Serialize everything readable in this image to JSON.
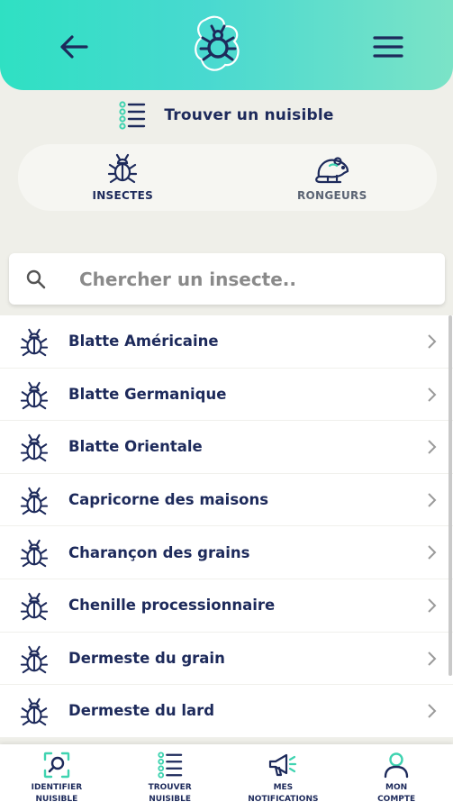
{
  "header": {
    "back_icon": "arrow-left-icon",
    "logo_icon": "bug-logo-icon",
    "menu_icon": "hamburger-menu-icon"
  },
  "page": {
    "title": "Trouver un nuisible",
    "title_icon": "list-icon"
  },
  "tabs": [
    {
      "label": "INSECTES",
      "icon": "bug-icon",
      "active": true
    },
    {
      "label": "RONGEURS",
      "icon": "rodent-icon",
      "active": false
    }
  ],
  "search": {
    "placeholder": "Chercher un insecte..",
    "value": ""
  },
  "list": {
    "items": [
      {
        "label": "Blatte Américaine"
      },
      {
        "label": "Blatte Germanique"
      },
      {
        "label": "Blatte Orientale"
      },
      {
        "label": "Capricorne des maisons"
      },
      {
        "label": "Charançon des grains"
      },
      {
        "label": "Chenille processionnaire"
      },
      {
        "label": "Dermeste du grain"
      },
      {
        "label": "Dermeste du lard"
      }
    ]
  },
  "bottom_nav": [
    {
      "label": "IDENTIFIER\nNUISIBLE",
      "icon": "scan-search-icon"
    },
    {
      "label": "TROUVER\nNUISIBLE",
      "icon": "list-icon"
    },
    {
      "label": "MES\nNOTIFICATIONS",
      "icon": "megaphone-icon"
    },
    {
      "label": "MON\nCOMPTE",
      "icon": "user-icon"
    }
  ],
  "colors": {
    "primary_dark": "#1d2a5b",
    "accent_teal": "#2fd6b4",
    "header_gradient_start": "#2fe0c3",
    "header_gradient_end": "#7be3c7",
    "background": "#efefe9"
  }
}
